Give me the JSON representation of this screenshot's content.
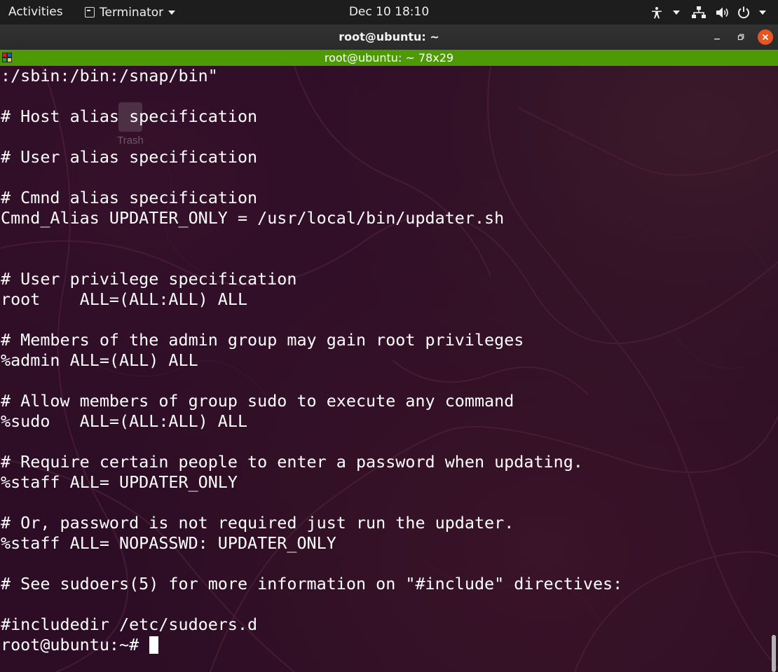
{
  "topbar": {
    "activities": "Activities",
    "app_name": "Terminator",
    "clock": "Dec 10  18:10",
    "icons": [
      "accessibility-icon",
      "network-icon",
      "volume-icon",
      "power-icon"
    ]
  },
  "window": {
    "title": "root@ubuntu: ~"
  },
  "pane": {
    "title": "root@ubuntu: ~ 78x29",
    "header_color": "#4e9a06"
  },
  "desktop": {
    "trash_label": "Trash"
  },
  "terminal": {
    "background": "#2c0d25",
    "foreground": "#ffffff",
    "lines": [
      ":/sbin:/bin:/snap/bin\"",
      "",
      "# Host alias specification",
      "",
      "# User alias specification",
      "",
      "# Cmnd alias specification",
      "Cmnd_Alias UPDATER_ONLY = /usr/local/bin/updater.sh",
      "",
      "",
      "# User privilege specification",
      "root    ALL=(ALL:ALL) ALL",
      "",
      "# Members of the admin group may gain root privileges",
      "%admin ALL=(ALL) ALL",
      "",
      "# Allow members of group sudo to execute any command",
      "%sudo   ALL=(ALL:ALL) ALL",
      "",
      "# Require certain people to enter a password when updating.",
      "%staff ALL= UPDATER_ONLY",
      "",
      "# Or, password is not required just run the updater.",
      "%staff ALL= NOPASSWD: UPDATER_ONLY",
      "",
      "# See sudoers(5) for more information on \"#include\" directives:",
      "",
      "#includedir /etc/sudoers.d"
    ],
    "prompt": "root@ubuntu:~# "
  }
}
